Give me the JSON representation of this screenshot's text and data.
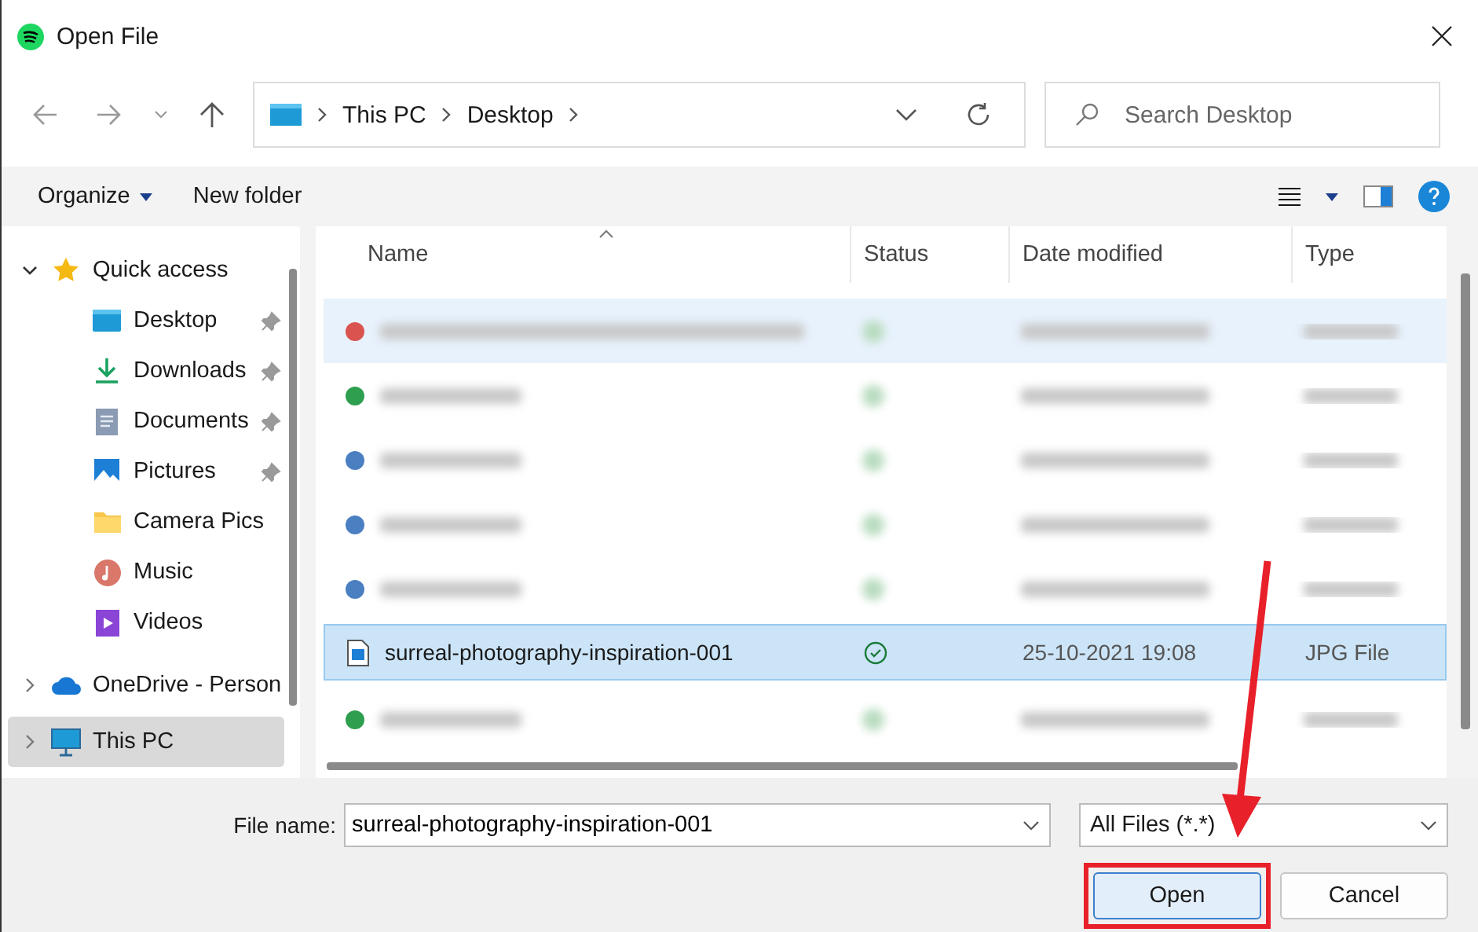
{
  "window": {
    "title": "Open File"
  },
  "breadcrumb": [
    "This PC",
    "Desktop"
  ],
  "search": {
    "placeholder": "Search Desktop"
  },
  "toolbar": {
    "organize": "Organize",
    "new_folder": "New folder"
  },
  "sidebar": {
    "items": [
      {
        "label": "Quick access",
        "kind": "star",
        "expanded": true,
        "selected": false,
        "children": [
          {
            "label": "Desktop",
            "kind": "desktop",
            "pinned": true,
            "selected": false
          },
          {
            "label": "Downloads",
            "kind": "download",
            "pinned": true,
            "selected": false
          },
          {
            "label": "Documents",
            "kind": "documents",
            "pinned": true,
            "selected": false
          },
          {
            "label": "Pictures",
            "kind": "pictures",
            "pinned": true,
            "selected": false
          },
          {
            "label": "Camera Pics",
            "kind": "folder",
            "selected": false
          },
          {
            "label": "Music",
            "kind": "music",
            "selected": false
          },
          {
            "label": "Videos",
            "kind": "videos",
            "selected": false
          }
        ]
      },
      {
        "label": "OneDrive - Person",
        "kind": "cloud",
        "expanded": false,
        "selected": false
      },
      {
        "label": "This PC",
        "kind": "computer",
        "expanded": false,
        "selected": true
      }
    ]
  },
  "table": {
    "columns": [
      "Name",
      "Status",
      "Date modified",
      "Type"
    ],
    "rows": [
      {
        "kind": "blurred",
        "selected": false,
        "highlighted": true,
        "color": "#d9534f"
      },
      {
        "kind": "blurred",
        "selected": false,
        "highlighted": false,
        "color": "#2e9e4f"
      },
      {
        "kind": "blurred",
        "selected": false,
        "highlighted": false,
        "color": "#4a7fc1"
      },
      {
        "kind": "blurred",
        "selected": false,
        "highlighted": false,
        "color": "#4a7fc1"
      },
      {
        "kind": "blurred",
        "selected": false,
        "highlighted": false,
        "color": "#4a7fc1"
      },
      {
        "kind": "file",
        "selected": true,
        "name": "surreal-photography-inspiration-001",
        "date": "25-10-2021 19:08",
        "type": "JPG File"
      },
      {
        "kind": "blurred",
        "selected": false,
        "highlighted": false,
        "color": "#2e9e4f"
      }
    ]
  },
  "footer": {
    "file_name_label": "File name:",
    "file_name": "surreal-photography-inspiration-001",
    "filter": "All Files (*.*)",
    "open": "Open",
    "cancel": "Cancel"
  }
}
